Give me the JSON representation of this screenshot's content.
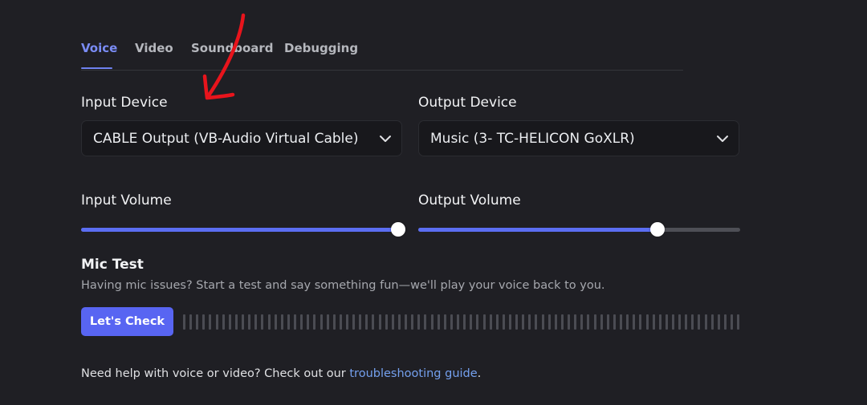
{
  "tabs": [
    {
      "label": "Voice",
      "active": true
    },
    {
      "label": "Video",
      "active": false
    },
    {
      "label": "Soundboard",
      "active": false
    },
    {
      "label": "Debugging",
      "active": false
    }
  ],
  "input_device": {
    "label": "Input Device",
    "value": "CABLE Output (VB-Audio Virtual Cable)"
  },
  "output_device": {
    "label": "Output Device",
    "value": "Music (3- TC-HELICON GoXLR)"
  },
  "input_volume": {
    "label": "Input Volume",
    "fraction": 0.985
  },
  "output_volume": {
    "label": "Output Volume",
    "fraction": 0.744
  },
  "mic_test": {
    "title": "Mic Test",
    "description": "Having mic issues? Start a test and say something fun—we'll play your voice back to you.",
    "button_label": "Let's Check"
  },
  "help": {
    "prefix": "Need help with voice or video? Check out our ",
    "link_text": "troubleshooting guide",
    "suffix": "."
  },
  "colors": {
    "background": "#1f1f24",
    "accent": "#5865f2",
    "link": "#74a0ee",
    "annotation": "#e8141c"
  },
  "icons": {
    "dropdown": "chevron-down-icon",
    "annotation": "red-arrow-annotation"
  }
}
